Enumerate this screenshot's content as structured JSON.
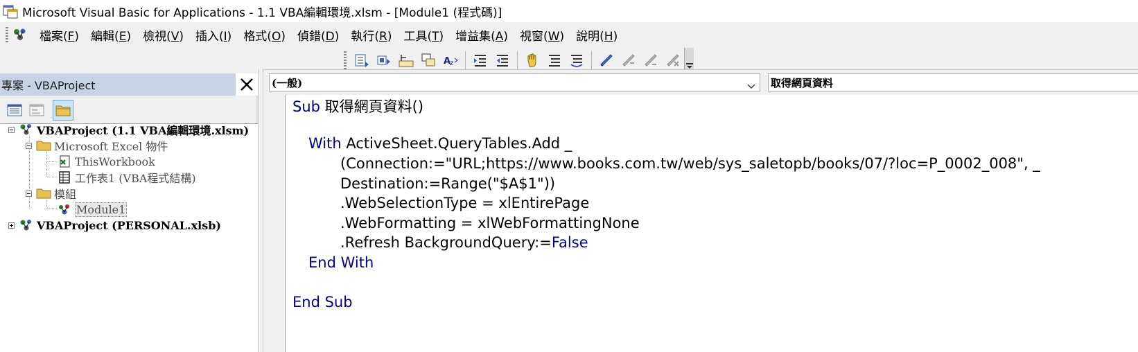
{
  "window": {
    "title": "Microsoft Visual Basic for Applications - 1.1 VBA編輯環境.xlsm - [Module1 (程式碼)]"
  },
  "menu": [
    {
      "label": "檔案(",
      "key": "F",
      "end": ")"
    },
    {
      "label": "編輯(",
      "key": "E",
      "end": ")"
    },
    {
      "label": "檢視(",
      "key": "V",
      "end": ")"
    },
    {
      "label": "插入(",
      "key": "I",
      "end": ")"
    },
    {
      "label": "格式(",
      "key": "O",
      "end": ")"
    },
    {
      "label": "偵錯(",
      "key": "D",
      "end": ")"
    },
    {
      "label": "執行(",
      "key": "R",
      "end": ")"
    },
    {
      "label": "工具(",
      "key": "T",
      "end": ")"
    },
    {
      "label": "增益集(",
      "key": "A",
      "end": ")"
    },
    {
      "label": "視窗(",
      "key": "W",
      "end": ")"
    },
    {
      "label": "說明(",
      "key": "H",
      "end": ")"
    }
  ],
  "project": {
    "title": "專案 - VBAProject",
    "tree": {
      "p1": "VBAProject (1.1 VBA編輯環境.xlsm)",
      "excel_objects": "Microsoft Excel 物件",
      "thisworkbook": "ThisWorkbook",
      "sheet1": "工作表1 (VBA程式結構)",
      "modules": "模組",
      "module1": "Module1",
      "p2": "VBAProject (PERSONAL.xlsb)"
    }
  },
  "code": {
    "object_combo": "(一般)",
    "proc_combo": "取得網頁資料",
    "lines": {
      "l1_kw": "Sub",
      "l1_rest": " 取得網頁資料()",
      "l3_kw": "With",
      "l3_rest": " ActiveSheet.QueryTables.Add _",
      "l4": "(Connection:=\"URL;https://www.books.com.tw/web/sys_saletopb/books/07/?loc=P_0002_008\", _",
      "l5": "Destination:=Range(\"$A$1\"))",
      "l6": ".WebSelectionType = xlEntirePage",
      "l7": ".WebFormatting = xlWebFormattingNone",
      "l8_pre": ".Refresh BackgroundQuery:=",
      "l8_kw": "False",
      "l9": "End With",
      "l11": "End Sub"
    }
  },
  "colors": {
    "keyword": "#00008b",
    "panel_header": "#c7d3e3"
  }
}
